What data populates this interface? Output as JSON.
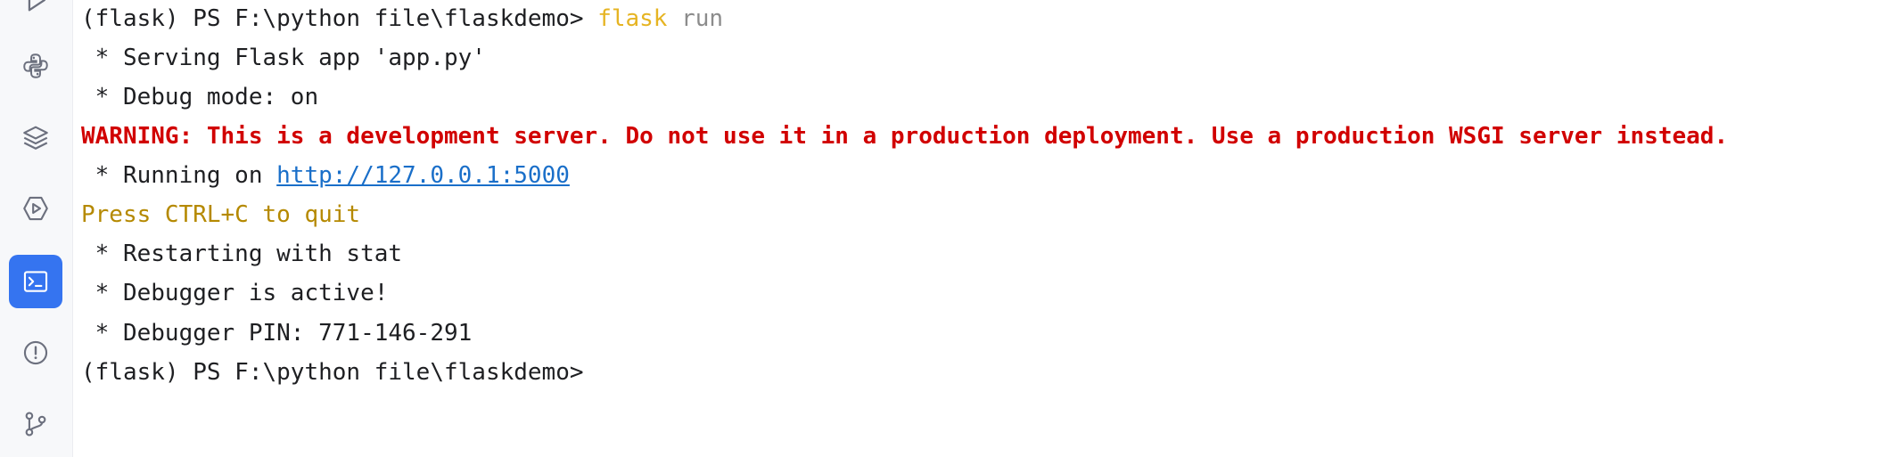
{
  "sidebar": {
    "items": [
      {
        "icon": "run-icon",
        "active": false
      },
      {
        "icon": "python-console-icon",
        "active": false
      },
      {
        "icon": "layers-icon",
        "active": false
      },
      {
        "icon": "services-icon",
        "active": false
      },
      {
        "icon": "terminal-icon",
        "active": true
      },
      {
        "icon": "problems-icon",
        "active": false
      },
      {
        "icon": "git-icon",
        "active": false
      }
    ]
  },
  "terminal": {
    "prompt1": "(flask) PS F:\\python file\\flaskdemo> ",
    "cmd_flask": "flask",
    "cmd_run": " run",
    "line_serving": " * Serving Flask app 'app.py'",
    "line_debug": " * Debug mode: on",
    "line_warning": "WARNING: This is a development server. Do not use it in a production deployment. Use a production WSGI server instead.",
    "line_running_prefix": " * Running on ",
    "running_url": "http://127.0.0.1:5000",
    "line_quit": "Press CTRL+C to quit",
    "line_restart": " * Restarting with stat",
    "line_debugger": " * Debugger is active!",
    "line_pin": " * Debugger PIN: 771-146-291",
    "prompt2": "(flask) PS F:\\python file\\flaskdemo>"
  },
  "colors": {
    "warning": "#d10000",
    "quit": "#b58900",
    "link": "#1a6fc9",
    "active_tool": "#3574f0"
  }
}
